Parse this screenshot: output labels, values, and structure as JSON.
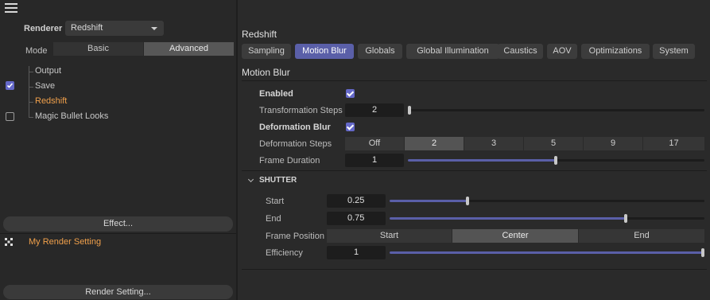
{
  "left": {
    "renderer_label": "Renderer",
    "renderer_value": "Redshift",
    "mode_label": "Mode",
    "mode_basic": "Basic",
    "mode_advanced": "Advanced",
    "tree": [
      {
        "label": "Output",
        "checked": null
      },
      {
        "label": "Save",
        "checked": true
      },
      {
        "label": "Redshift",
        "checked": null
      },
      {
        "label": "Magic Bullet Looks",
        "checked": false
      }
    ],
    "effect_button": "Effect...",
    "render_setting_item": "My Render Setting",
    "render_setting_button": "Render Setting..."
  },
  "right": {
    "title": "Redshift",
    "tabs": [
      "Sampling",
      "Motion Blur",
      "Globals",
      "Global Illumination",
      "Caustics",
      "AOV",
      "Optimizations",
      "System"
    ],
    "section_title": "Motion Blur",
    "enabled_label": "Enabled",
    "transformation_steps_label": "Transformation Steps",
    "transformation_steps_value": "2",
    "deformation_blur_label": "Deformation Blur",
    "deformation_steps_label": "Deformation Steps",
    "deformation_steps_options": [
      "Off",
      "2",
      "3",
      "5",
      "9",
      "17"
    ],
    "deformation_steps_selected": "2",
    "frame_duration_label": "Frame Duration",
    "frame_duration_value": "1",
    "shutter": {
      "title": "SHUTTER",
      "start_label": "Start",
      "start_value": "0.25",
      "end_label": "End",
      "end_value": "0.75",
      "frame_position_label": "Frame Position",
      "frame_position_options": [
        "Start",
        "Center",
        "End"
      ],
      "frame_position_selected": "Center",
      "efficiency_label": "Efficiency",
      "efficiency_value": "1"
    }
  },
  "colors": {
    "accent": "#5a5fa8",
    "active_item": "#f0a04b"
  }
}
